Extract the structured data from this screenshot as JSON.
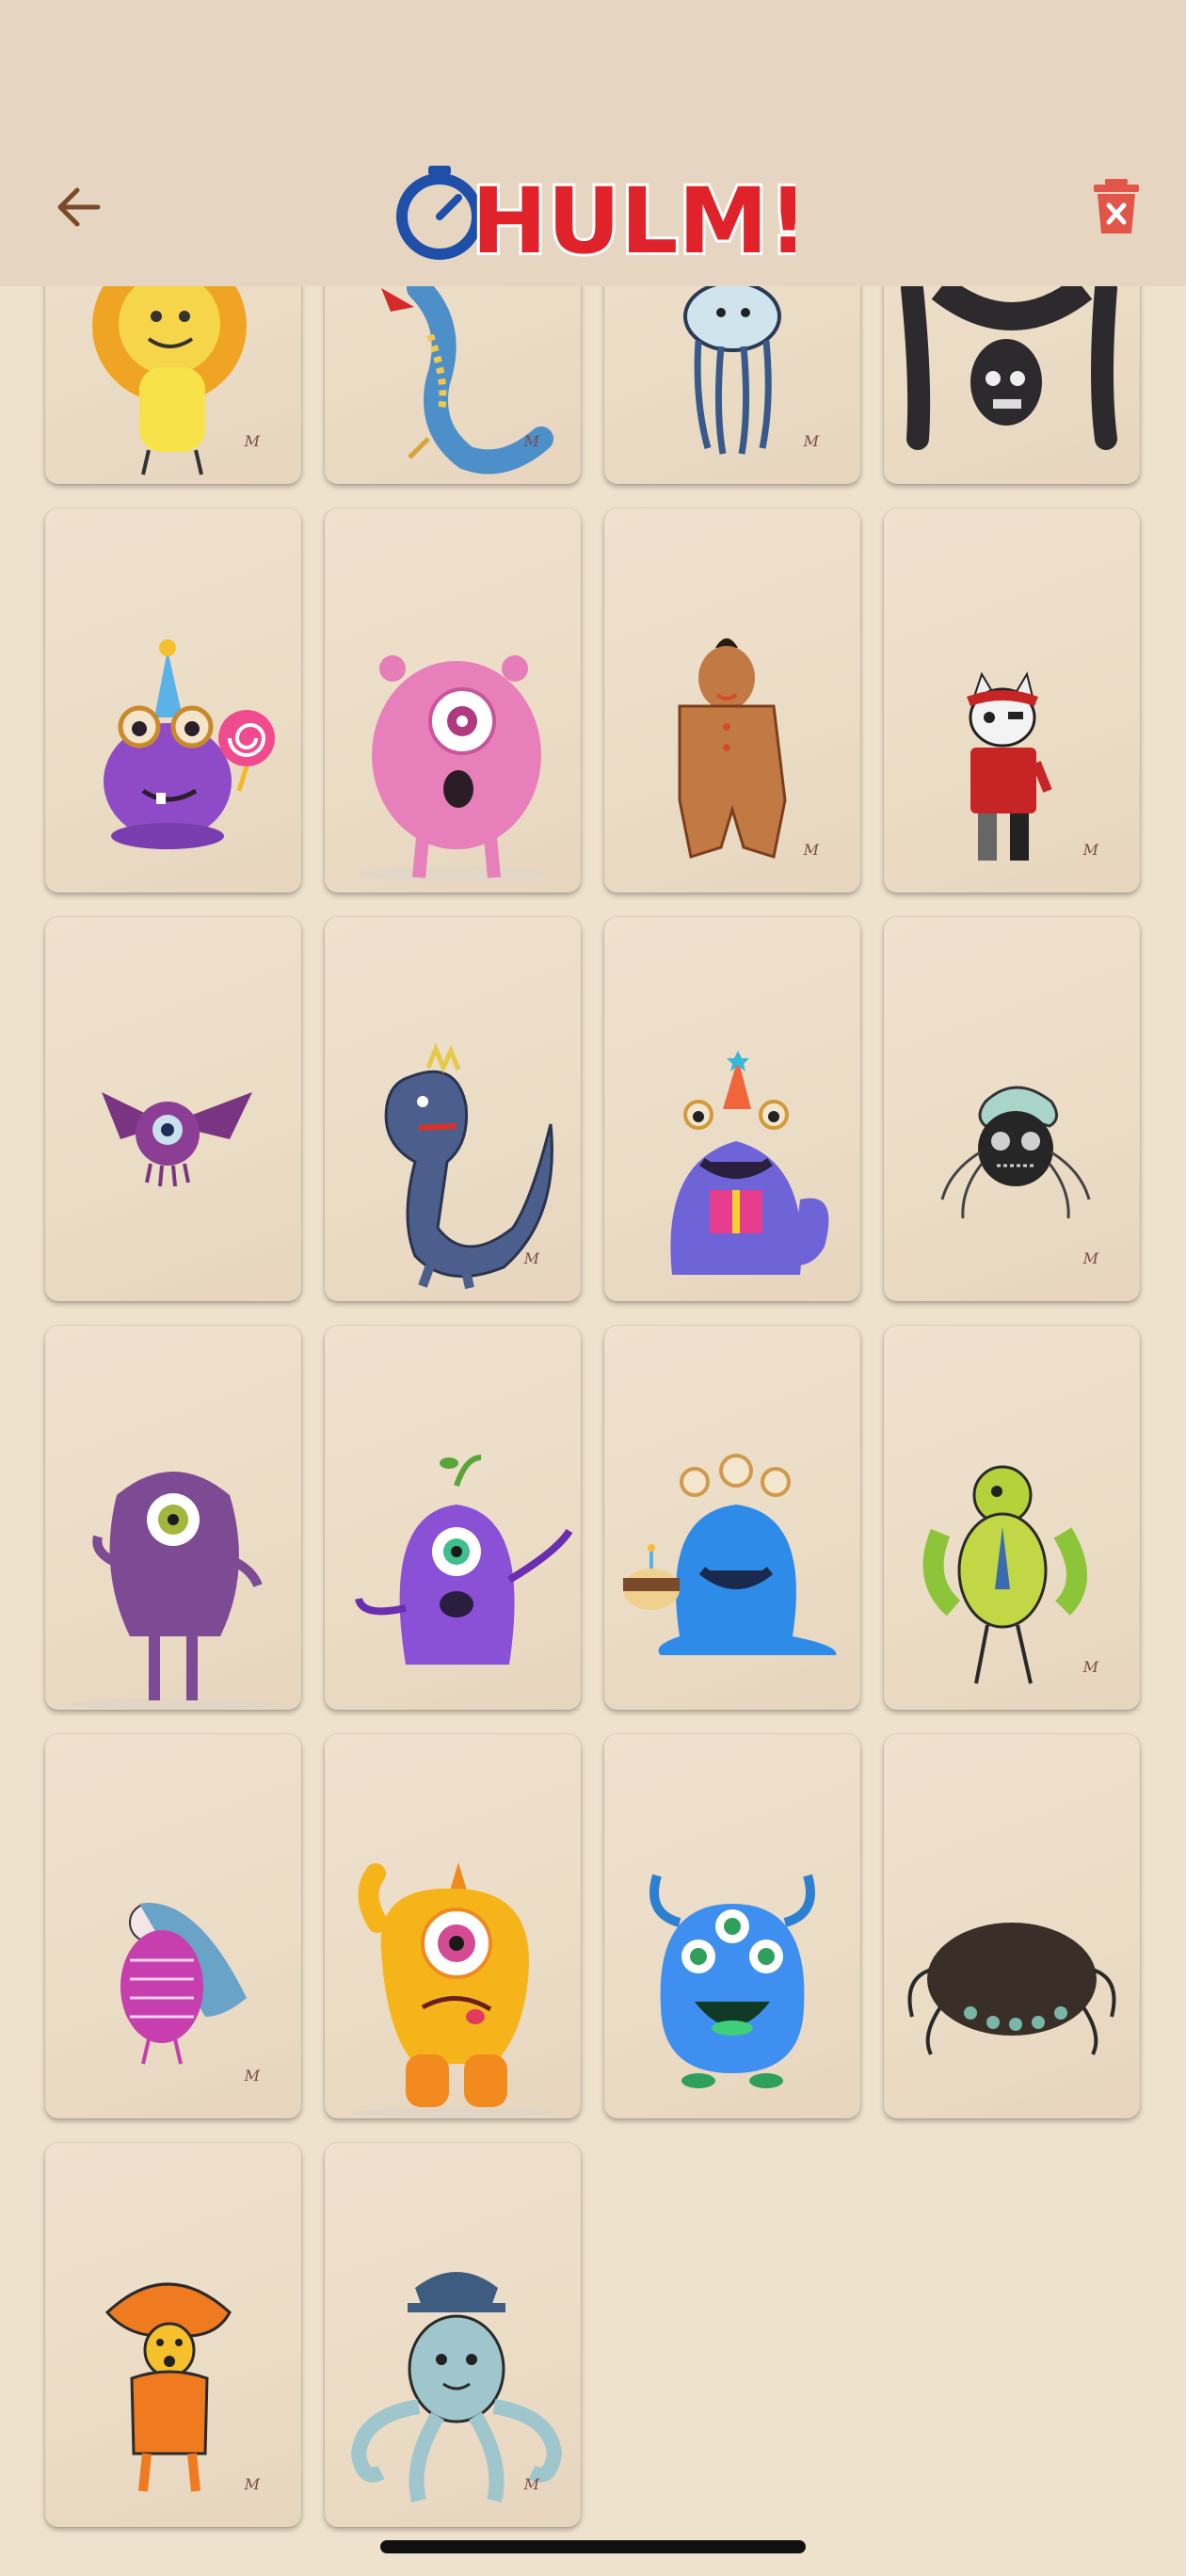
{
  "app": {
    "logo_text": "HULM!",
    "logo_colors": {
      "stopwatch": "#1f4fa8",
      "letters": "#e0232b",
      "exclaim": "#1f4fa8"
    }
  },
  "header": {
    "back_icon": "arrow-left-icon",
    "delete_icon": "trash-delete-icon",
    "accent_delete": "#e25549"
  },
  "gallery": {
    "signature_mark": "M",
    "cards": [
      {
        "name": "lion-monster"
      },
      {
        "name": "blue-dragon-monster"
      },
      {
        "name": "long-legged-jellyfish-monster"
      },
      {
        "name": "hanging-black-furry-monster"
      },
      {
        "name": "purple-party-monster-with-lollipop"
      },
      {
        "name": "pink-one-eyed-monster"
      },
      {
        "name": "brown-gingerbread-monster"
      },
      {
        "name": "pirate-cat-monster"
      },
      {
        "name": "purple-bat-eye-monster"
      },
      {
        "name": "blue-dinosaur-monster"
      },
      {
        "name": "blue-party-monster-with-gift"
      },
      {
        "name": "black-spider-creature"
      },
      {
        "name": "purple-furry-cyclops-monster"
      },
      {
        "name": "purple-sprout-monster"
      },
      {
        "name": "blue-slime-monster-with-cake"
      },
      {
        "name": "green-bird-monster"
      },
      {
        "name": "pink-feathered-bird-monster"
      },
      {
        "name": "orange-furry-unicorn-monster"
      },
      {
        "name": "blue-three-eyed-monster"
      },
      {
        "name": "dark-brown-spider-monster"
      },
      {
        "name": "orange-mushroom-monster"
      },
      {
        "name": "blue-octopus-monster"
      }
    ]
  }
}
